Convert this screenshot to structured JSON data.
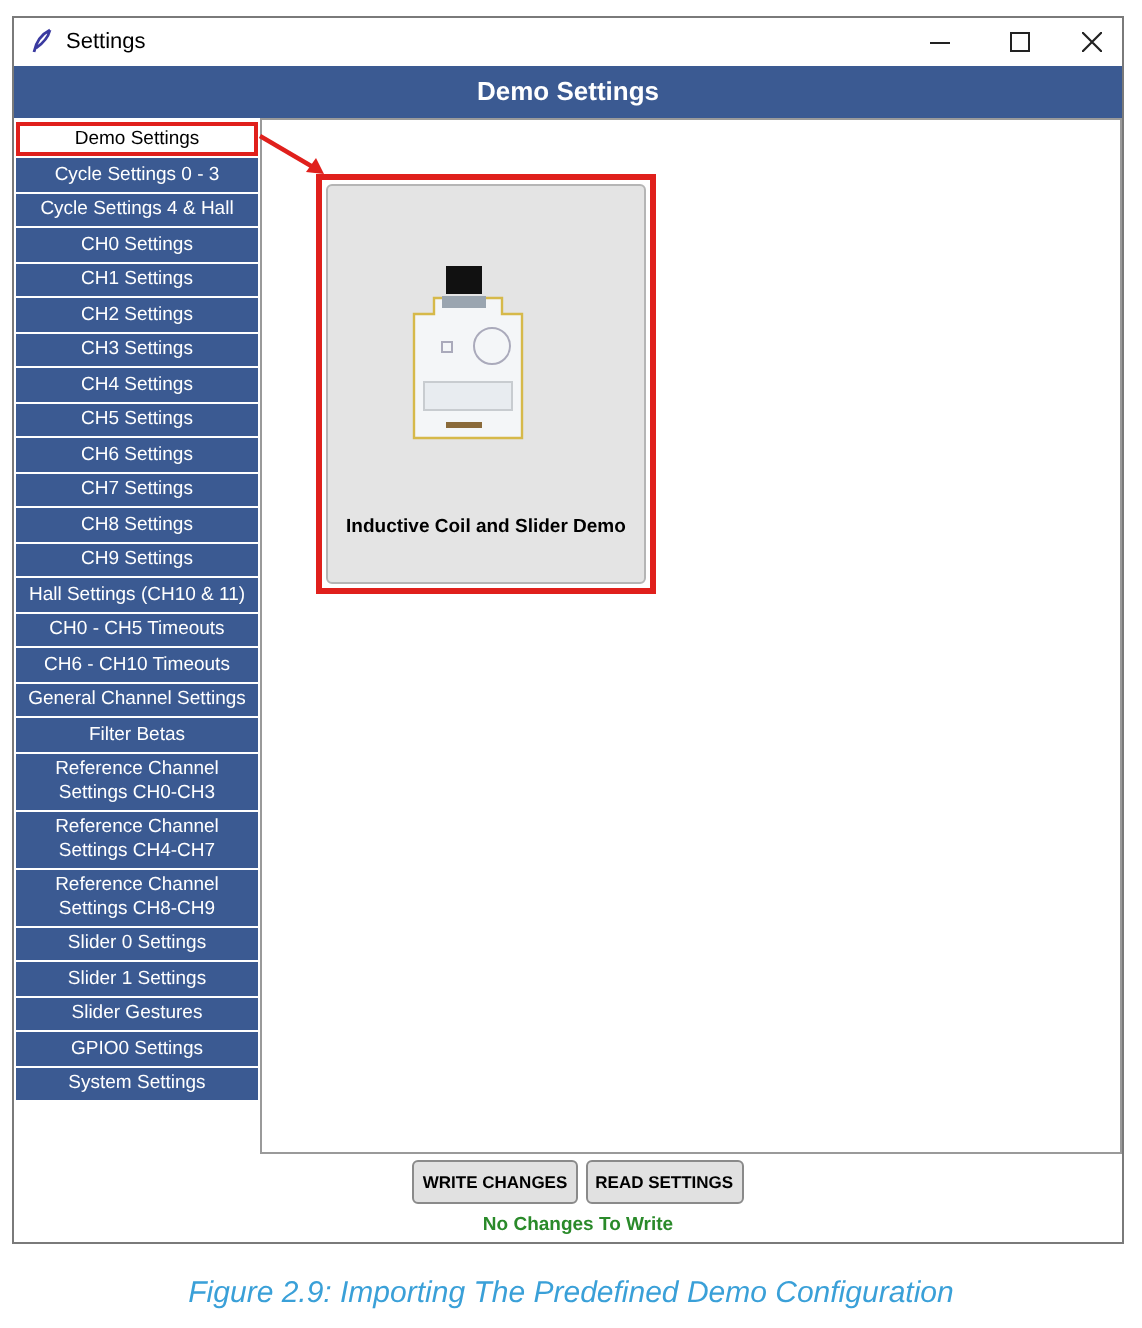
{
  "window": {
    "title": "Settings"
  },
  "header": {
    "title": "Demo Settings"
  },
  "sidebar": {
    "items": [
      {
        "label": "Demo Settings",
        "selected": true
      },
      {
        "label": "Cycle Settings 0 - 3",
        "selected": false
      },
      {
        "label": "Cycle Settings 4 & Hall",
        "selected": false
      },
      {
        "label": "CH0 Settings",
        "selected": false
      },
      {
        "label": "CH1 Settings",
        "selected": false
      },
      {
        "label": "CH2 Settings",
        "selected": false
      },
      {
        "label": "CH3 Settings",
        "selected": false
      },
      {
        "label": "CH4 Settings",
        "selected": false
      },
      {
        "label": "CH5 Settings",
        "selected": false
      },
      {
        "label": "CH6 Settings",
        "selected": false
      },
      {
        "label": "CH7 Settings",
        "selected": false
      },
      {
        "label": "CH8 Settings",
        "selected": false
      },
      {
        "label": "CH9 Settings",
        "selected": false
      },
      {
        "label": "Hall Settings (CH10 & 11)",
        "selected": false
      },
      {
        "label": "CH0 - CH5 Timeouts",
        "selected": false
      },
      {
        "label": "CH6 - CH10 Timeouts",
        "selected": false
      },
      {
        "label": "General Channel Settings",
        "selected": false
      },
      {
        "label": "Filter Betas",
        "selected": false
      },
      {
        "label": "Reference Channel Settings CH0-CH3",
        "selected": false
      },
      {
        "label": "Reference Channel Settings CH4-CH7",
        "selected": false
      },
      {
        "label": "Reference Channel Settings CH8-CH9",
        "selected": false
      },
      {
        "label": "Slider 0 Settings",
        "selected": false
      },
      {
        "label": "Slider 1 Settings",
        "selected": false
      },
      {
        "label": "Slider Gestures",
        "selected": false
      },
      {
        "label": "GPIO0 Settings",
        "selected": false
      },
      {
        "label": "System Settings",
        "selected": false
      }
    ]
  },
  "demos": [
    {
      "label": "Inductive Coil and Slider Demo",
      "kind": "picture"
    }
  ],
  "buttons": [
    "WRITE CHANGES",
    "READ SETTINGS"
  ],
  "status": "No Changes To Write",
  "caption": "Figure 2.9: Importing The Predefined Demo Configuration"
}
